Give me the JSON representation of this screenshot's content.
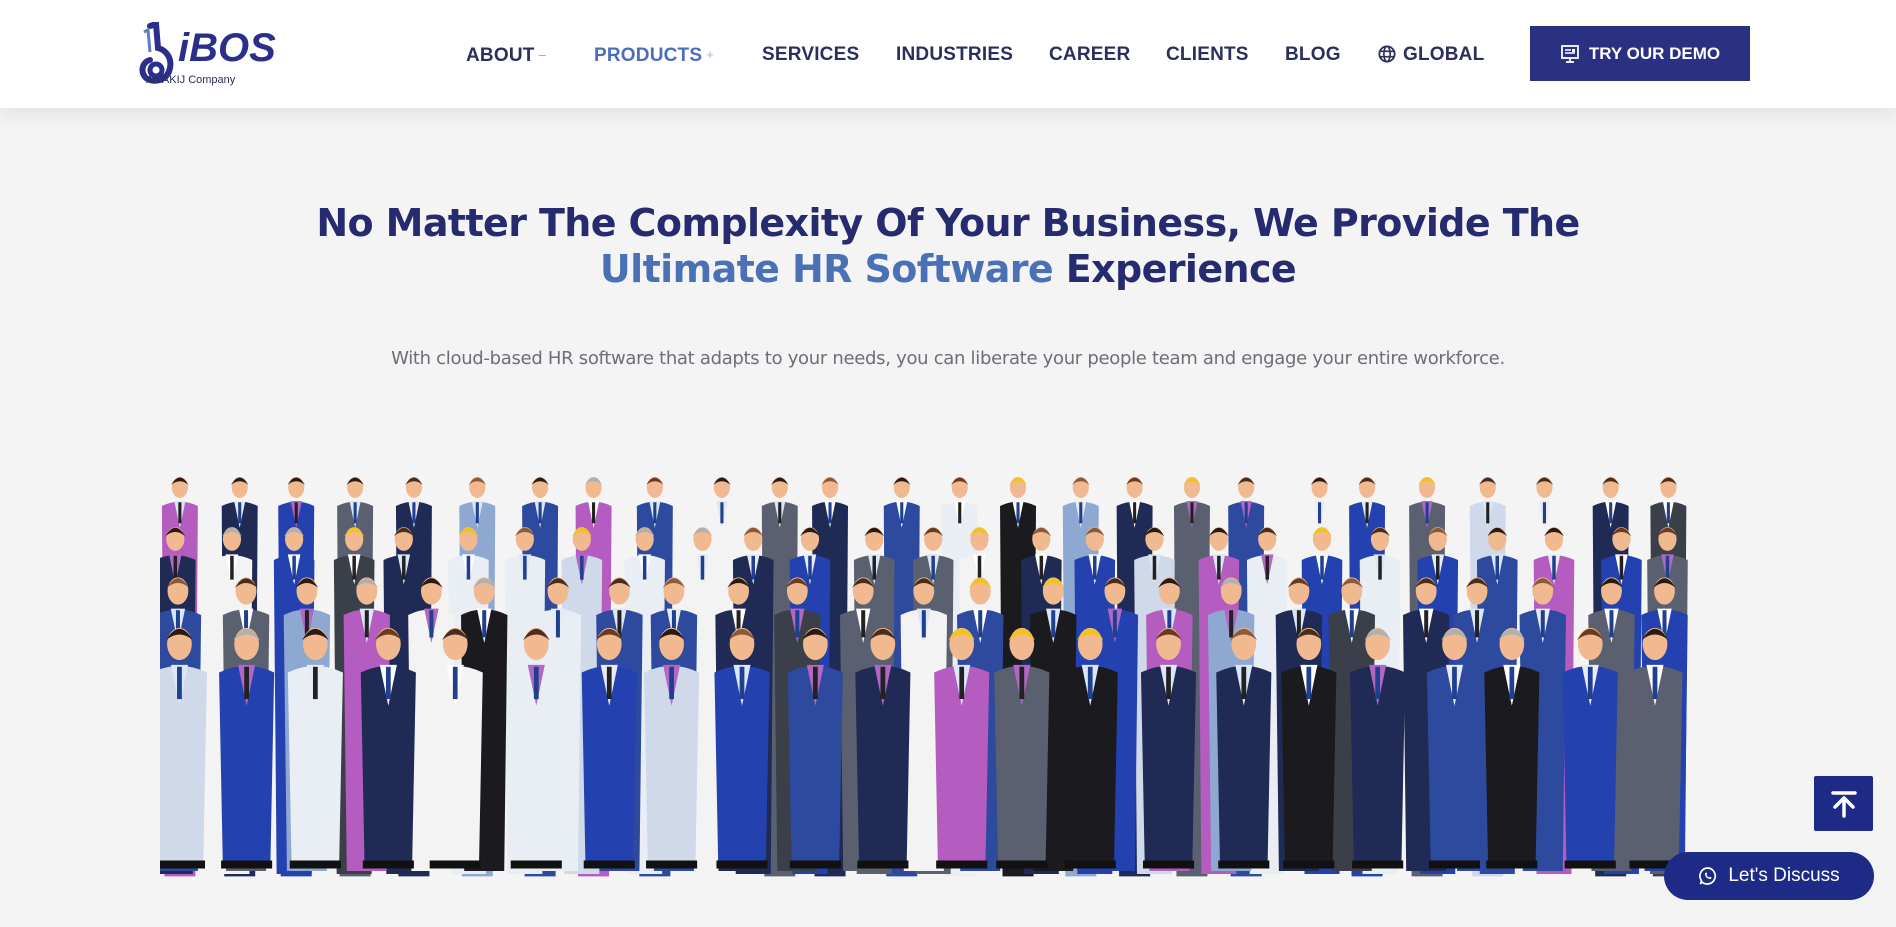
{
  "brand": {
    "name": "iBOS",
    "tagline": "An AKIJ Company",
    "primary_color": "#2a3183",
    "accent_color": "#4a71b5",
    "text_color": "#262a6e"
  },
  "nav": {
    "items": [
      {
        "label": "ABOUT",
        "suffix": "–",
        "active": false
      },
      {
        "label": "PRODUCTS",
        "suffix": "+",
        "active": true
      },
      {
        "label": "SERVICES",
        "suffix": "",
        "active": false
      },
      {
        "label": "INDUSTRIES",
        "suffix": "",
        "active": false
      },
      {
        "label": "CAREER",
        "suffix": "",
        "active": false
      },
      {
        "label": "CLIENTS",
        "suffix": "",
        "active": false
      },
      {
        "label": "BLOG",
        "suffix": "",
        "active": false
      },
      {
        "label": "GLOBAL",
        "suffix": "",
        "active": false,
        "icon": "globe-icon"
      }
    ],
    "cta_label": "TRY OUR DEMO",
    "cta_icon": "monitor-icon"
  },
  "hero": {
    "title_line1": "No Matter The Complexity Of Your Business, We Provide The",
    "title_highlight": "Ultimate HR Software",
    "title_rest": " Experience",
    "subtitle": "With cloud-based HR software that adapts to your needs, you can liberate your people team and engage your entire workforce.",
    "image_alt": "Illustration of a large diverse crowd of professionals"
  },
  "floating": {
    "scroll_top_icon": "arrow-up-to-top-icon",
    "discuss_label": "Let's Discuss",
    "discuss_icon": "whatsapp-icon"
  }
}
